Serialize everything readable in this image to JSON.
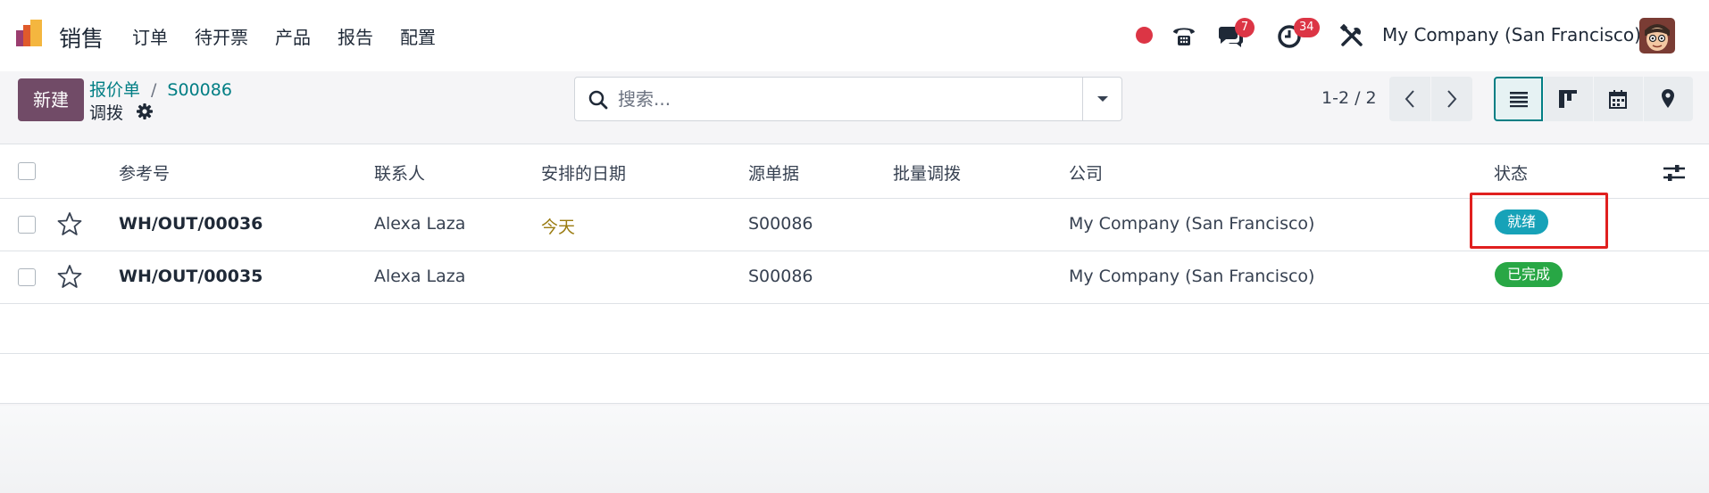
{
  "app": {
    "name": "销售",
    "logo_icon": "odoo-sales-logo-icon"
  },
  "menu": [
    "订单",
    "待开票",
    "产品",
    "报告",
    "配置"
  ],
  "navbar": {
    "chat_badge": "7",
    "activity_badge": "34",
    "company": "My Company (San Francisco)"
  },
  "control": {
    "new_label": "新建",
    "breadcrumb_parent": "报价单",
    "breadcrumb_separator": "/",
    "breadcrumb_current": "S00086",
    "title": "调拨",
    "search_placeholder": "搜索...",
    "pager": "1-2 / 2"
  },
  "table": {
    "headers": [
      "参考号",
      "联系人",
      "安排的日期",
      "源单据",
      "批量调拨",
      "公司",
      "状态"
    ],
    "rows": [
      {
        "ref": "WH/OUT/00036",
        "contact": "Alexa Laza",
        "date": "今天",
        "source": "S00086",
        "batch": "",
        "company": "My Company (San Francisco)",
        "status": "就绪"
      },
      {
        "ref": "WH/OUT/00035",
        "contact": "Alexa Laza",
        "date": "",
        "source": "S00086",
        "batch": "",
        "company": "My Company (San Francisco)",
        "status": "已完成"
      }
    ]
  },
  "colors": {
    "brand": "#714b67",
    "accent": "#017e84",
    "ready": "#17a2b8",
    "done": "#28a745",
    "highlight": "#e0201f"
  }
}
